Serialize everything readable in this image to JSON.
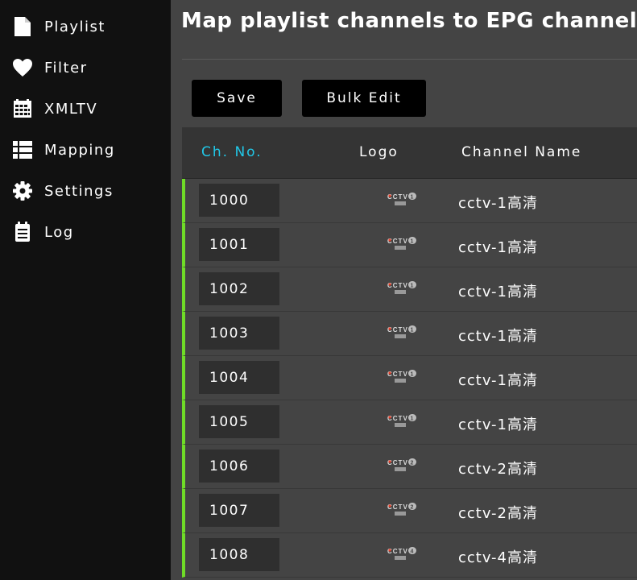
{
  "sidebar": {
    "items": [
      {
        "label": "Playlist",
        "icon": "file-icon"
      },
      {
        "label": "Filter",
        "icon": "heart-icon"
      },
      {
        "label": "XMLTV",
        "icon": "calendar-grid-icon"
      },
      {
        "label": "Mapping",
        "icon": "list-icon"
      },
      {
        "label": "Settings",
        "icon": "gear-icon"
      },
      {
        "label": "Log",
        "icon": "clipboard-icon"
      }
    ]
  },
  "main": {
    "title": "Map playlist channels to EPG channels",
    "buttons": {
      "save": "Save",
      "bulk_edit": "Bulk Edit"
    },
    "table": {
      "headers": {
        "ch_no": "Ch. No.",
        "logo": "Logo",
        "name": "Channel Name"
      },
      "rows": [
        {
          "ch_no": "1000",
          "logo_text": "CCTV",
          "logo_num": "1",
          "name": "cctv-1高清"
        },
        {
          "ch_no": "1001",
          "logo_text": "CCTV",
          "logo_num": "1",
          "name": "cctv-1高清"
        },
        {
          "ch_no": "1002",
          "logo_text": "CCTV",
          "logo_num": "1",
          "name": "cctv-1高清"
        },
        {
          "ch_no": "1003",
          "logo_text": "CCTV",
          "logo_num": "1",
          "name": "cctv-1高清"
        },
        {
          "ch_no": "1004",
          "logo_text": "CCTV",
          "logo_num": "1",
          "name": "cctv-1高清"
        },
        {
          "ch_no": "1005",
          "logo_text": "CCTV",
          "logo_num": "1",
          "name": "cctv-1高清"
        },
        {
          "ch_no": "1006",
          "logo_text": "CCTV",
          "logo_num": "2",
          "name": "cctv-2高清"
        },
        {
          "ch_no": "1007",
          "logo_text": "CCTV",
          "logo_num": "2",
          "name": "cctv-2高清"
        },
        {
          "ch_no": "1008",
          "logo_text": "CCTV",
          "logo_num": "4",
          "name": "cctv-4高清"
        }
      ]
    }
  },
  "colors": {
    "sidebar_bg": "#111111",
    "main_bg": "#444444",
    "header_bg": "#343434",
    "accent_cyan": "#21c8e8",
    "row_marker_green": "#6fdc27",
    "button_bg": "#000000",
    "input_bg": "#2f2f2f"
  }
}
